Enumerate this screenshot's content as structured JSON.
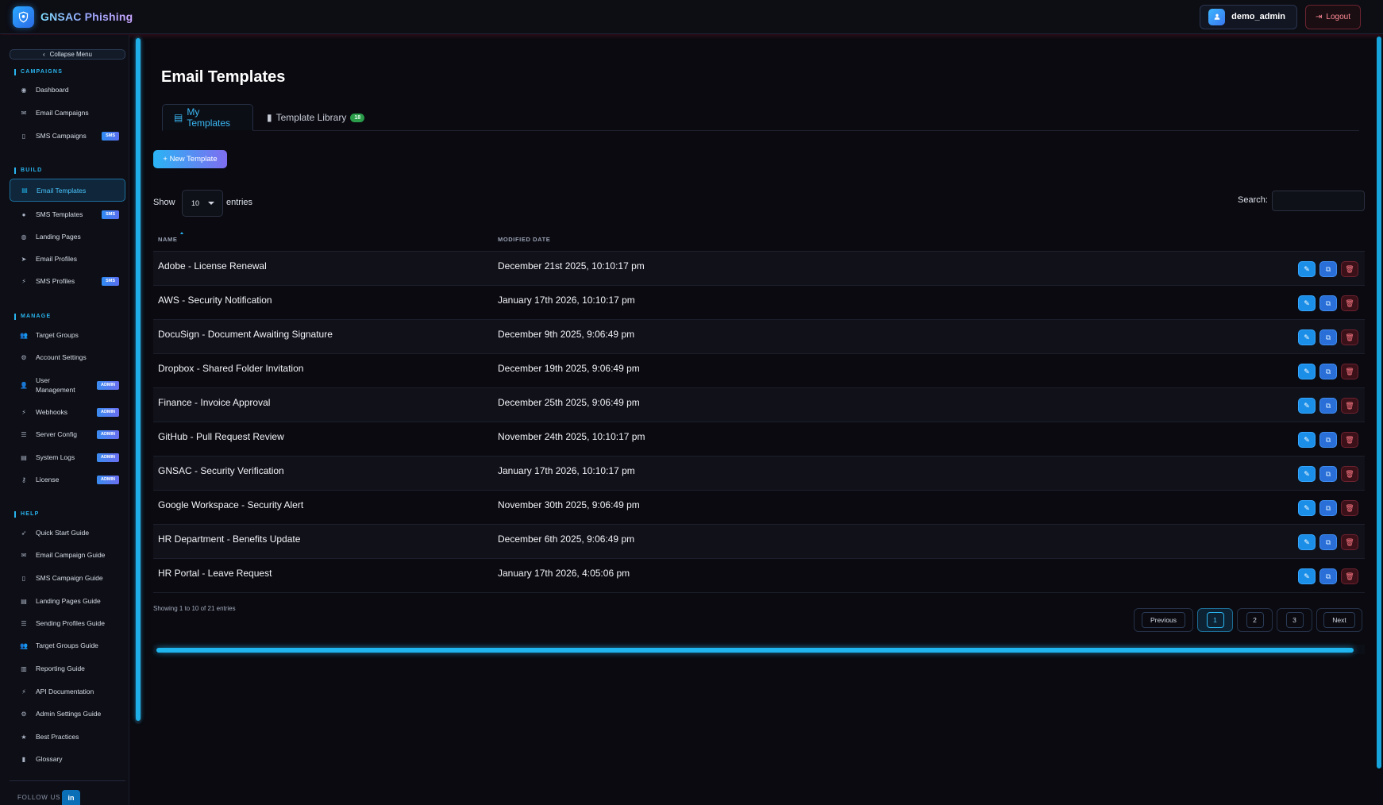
{
  "app": {
    "brand": "GNSAC Phishing",
    "user": "demo_admin",
    "logout_label": "Logout",
    "accent": "#29b4ef"
  },
  "sidebar": {
    "collapse_label": "Collapse Menu",
    "sections": [
      {
        "title": "CAMPAIGNS"
      },
      {
        "title": "BUILD"
      },
      {
        "title": "MANAGE"
      },
      {
        "title": "HELP"
      }
    ],
    "items": [
      {
        "label": "Dashboard",
        "icon": "dashboard-icon"
      },
      {
        "label": "Email Campaigns",
        "icon": "envelope-icon"
      },
      {
        "label": "SMS Campaigns",
        "icon": "mobile-icon",
        "badge": "SMS"
      },
      {
        "label": "Email Templates",
        "icon": "file-icon",
        "active": true
      },
      {
        "label": "SMS Templates",
        "icon": "comment-icon",
        "badge": "SMS"
      },
      {
        "label": "Landing Pages",
        "icon": "globe-icon"
      },
      {
        "label": "Email Profiles",
        "icon": "paper-plane-icon"
      },
      {
        "label": "SMS Profiles",
        "icon": "plug-icon",
        "badge": "SMS"
      },
      {
        "label": "Target Groups",
        "icon": "users-icon"
      },
      {
        "label": "Account Settings",
        "icon": "gear-icon"
      },
      {
        "label": "User Management",
        "icon": "user-gear-icon",
        "badge": "ADMIN"
      },
      {
        "label": "Webhooks",
        "icon": "plug-icon",
        "badge": "ADMIN"
      },
      {
        "label": "Server Config",
        "icon": "server-icon",
        "badge": "ADMIN"
      },
      {
        "label": "System Logs",
        "icon": "file-lines-icon",
        "badge": "ADMIN"
      },
      {
        "label": "License",
        "icon": "key-icon",
        "badge": "ADMIN"
      },
      {
        "label": "Quick Start Guide",
        "icon": "rocket-icon"
      },
      {
        "label": "Email Campaign Guide",
        "icon": "envelope-icon"
      },
      {
        "label": "SMS Campaign Guide",
        "icon": "mobile-icon"
      },
      {
        "label": "Landing Pages Guide",
        "icon": "file-icon"
      },
      {
        "label": "Sending Profiles Guide",
        "icon": "server-icon"
      },
      {
        "label": "Target Groups Guide",
        "icon": "users-icon"
      },
      {
        "label": "Reporting Guide",
        "icon": "chart-icon"
      },
      {
        "label": "API Documentation",
        "icon": "plug-icon"
      },
      {
        "label": "Admin Settings Guide",
        "icon": "gear-icon"
      },
      {
        "label": "Best Practices",
        "icon": "star-icon"
      },
      {
        "label": "Glossary",
        "icon": "book-icon"
      }
    ],
    "follow_label": "FOLLOW US",
    "linkedin_label": "in"
  },
  "main": {
    "title": "Email Templates",
    "tabs": [
      {
        "label": "My Templates",
        "active": true
      },
      {
        "label": "Template Library",
        "count": "18"
      }
    ],
    "new_button": "+ New Template",
    "show_label": "Show",
    "page_size": "10",
    "entries_label": "entries",
    "search_label": "Search:",
    "search_value": "",
    "columns": [
      "NAME",
      "MODIFIED DATE"
    ],
    "rows": [
      {
        "name": "Adobe - License Renewal",
        "date": "December 21st 2025, 10:10:17 pm"
      },
      {
        "name": "AWS - Security Notification",
        "date": "January 17th 2026, 10:10:17 pm"
      },
      {
        "name": "DocuSign - Document Awaiting Signature",
        "date": "December 9th 2025, 9:06:49 pm"
      },
      {
        "name": "Dropbox - Shared Folder Invitation",
        "date": "December 19th 2025, 9:06:49 pm"
      },
      {
        "name": "Finance - Invoice Approval",
        "date": "December 25th 2025, 9:06:49 pm"
      },
      {
        "name": "GitHub - Pull Request Review",
        "date": "November 24th 2025, 10:10:17 pm"
      },
      {
        "name": "GNSAC - Security Verification",
        "date": "January 17th 2026, 10:10:17 pm"
      },
      {
        "name": "Google Workspace - Security Alert",
        "date": "November 30th 2025, 9:06:49 pm"
      },
      {
        "name": "HR Department - Benefits Update",
        "date": "December 6th 2025, 9:06:49 pm"
      },
      {
        "name": "HR Portal - Leave Request",
        "date": "January 17th 2026, 4:05:06 pm"
      }
    ],
    "info": "Showing 1 to 10 of 21 entries",
    "pagination": {
      "previous": "Previous",
      "pages": [
        "1",
        "2",
        "3"
      ],
      "current": "1",
      "next": "Next"
    }
  }
}
